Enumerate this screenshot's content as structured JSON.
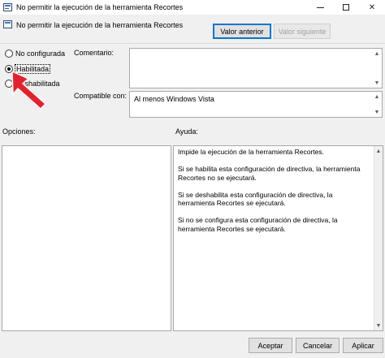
{
  "window": {
    "title": "No permitir la ejecución de la herramienta Recortes",
    "min_label": "",
    "close_label": "✕"
  },
  "header": {
    "policy_title": "No permitir la ejecución de la herramienta Recortes",
    "prev_button": "Valor anterior",
    "next_button": "Valor siguiente"
  },
  "state": {
    "options": [
      {
        "label": "No configurada",
        "checked": false
      },
      {
        "label": "Habilitada",
        "checked": true
      },
      {
        "label": "Deshabilitada",
        "checked": false
      }
    ]
  },
  "comment": {
    "label": "Comentario:",
    "value": ""
  },
  "compat": {
    "label": "Compatible con:",
    "value": "Al menos Windows Vista"
  },
  "panes": {
    "options_label": "Opciones:",
    "help_label": "Ayuda:"
  },
  "help": {
    "paragraphs": [
      "Impide la ejecución de la herramienta Recortes.",
      "Si se habilita esta configuración de directiva, la herramienta Recortes no se ejecutará.",
      "Si se deshabilita esta configuración de directiva, la herramienta Recortes se ejecutará.",
      "Si no se configura esta configuración de directiva, la herramienta Recortes se ejecutará."
    ]
  },
  "footer": {
    "ok": "Aceptar",
    "cancel": "Cancelar",
    "apply": "Aplicar"
  },
  "colors": {
    "accent": "#0078d7",
    "annotation_arrow": "#e8202a"
  }
}
